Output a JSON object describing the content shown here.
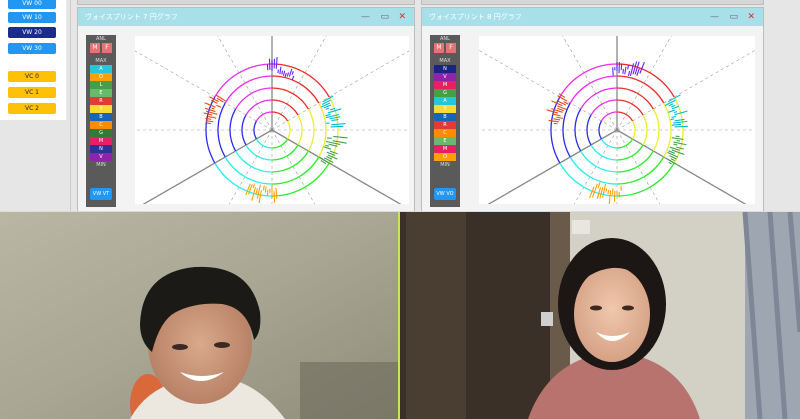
{
  "sidebar": {
    "vw_buttons": [
      "VW 00",
      "VW 10",
      "VW 20",
      "VW 30"
    ],
    "vc_buttons": [
      "VC 0",
      "VC 1",
      "VC 2"
    ]
  },
  "windows": [
    {
      "title": "ヴォイスプリント 7 円グラフ",
      "controls": {
        "minimize": "—",
        "restore": "▭",
        "close": "✕"
      },
      "palette_header": "ANL",
      "mode_buttons": [
        "M",
        "F"
      ],
      "max_label": "MAX",
      "min_label": "MIN",
      "swatches": [
        {
          "label": "A",
          "color": "#26c6da"
        },
        {
          "label": "O",
          "color": "#ffa000"
        },
        {
          "label": "L",
          "color": "#43a047"
        },
        {
          "label": "E",
          "color": "#66bb6a"
        },
        {
          "label": "R",
          "color": "#e53935"
        },
        {
          "label": "Y",
          "color": "#fdd835"
        },
        {
          "label": "B",
          "color": "#1565c0"
        },
        {
          "label": "C",
          "color": "#fb8c00"
        },
        {
          "label": "G",
          "color": "#2e7d32"
        },
        {
          "label": "M",
          "color": "#e91e63"
        },
        {
          "label": "N",
          "color": "#283593"
        },
        {
          "label": "V",
          "color": "#8e24aa"
        }
      ],
      "bottom_button": "VW VT"
    },
    {
      "title": "ヴォイスプリント 8 円グラフ",
      "controls": {
        "minimize": "—",
        "restore": "▭",
        "close": "✕"
      },
      "palette_header": "ANL",
      "mode_buttons": [
        "M",
        "F"
      ],
      "max_label": "MAX",
      "min_label": "MIN",
      "swatches": [
        {
          "label": "N",
          "color": "#1a237e"
        },
        {
          "label": "V",
          "color": "#8e24aa"
        },
        {
          "label": "M",
          "color": "#e91e63"
        },
        {
          "label": "G",
          "color": "#43a047"
        },
        {
          "label": "A",
          "color": "#26c6da"
        },
        {
          "label": "Y",
          "color": "#fdd835"
        },
        {
          "label": "B",
          "color": "#1565c0"
        },
        {
          "label": "R",
          "color": "#e53935"
        },
        {
          "label": "C",
          "color": "#fb8c00"
        },
        {
          "label": "E",
          "color": "#66bb6a"
        },
        {
          "label": "M",
          "color": "#e91e63"
        },
        {
          "label": "O",
          "color": "#ffa000"
        }
      ],
      "bottom_button": "VW VO"
    }
  ],
  "participants": [
    "participant-left",
    "participant-right"
  ]
}
